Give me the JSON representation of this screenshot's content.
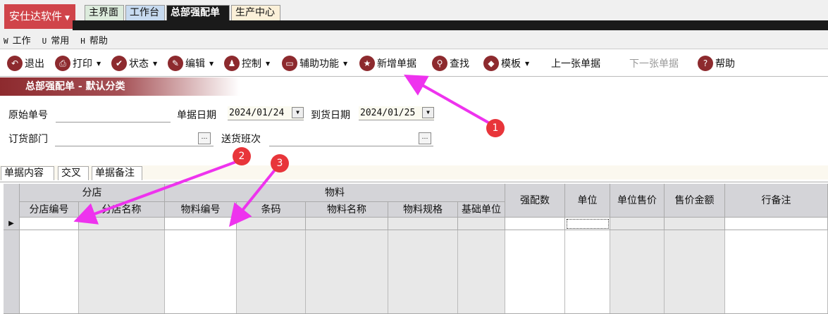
{
  "brand": {
    "label": "安仕达软件"
  },
  "window_tabs": [
    {
      "label": "主界面",
      "bg": "#dcebdc"
    },
    {
      "label": "工作台",
      "bg": "#c7daf0"
    },
    {
      "label": "总部强配单",
      "bg": "#1a1a1a",
      "active": true
    },
    {
      "label": "生产中心",
      "bg": "#fbf0d8"
    }
  ],
  "menu": [
    {
      "key": "W",
      "label": "工作"
    },
    {
      "key": "U",
      "label": "常用"
    },
    {
      "key": "H",
      "label": "帮助"
    }
  ],
  "toolbar": [
    {
      "label": "退出",
      "icon": "undo-icon",
      "glyph": "↶"
    },
    {
      "label": "打印",
      "icon": "printer-icon",
      "glyph": "⎙",
      "dropdown": true
    },
    {
      "label": "状态",
      "icon": "check-icon",
      "glyph": "✔",
      "dropdown": true
    },
    {
      "label": "编辑",
      "icon": "pencil-icon",
      "glyph": "✎",
      "dropdown": true
    },
    {
      "label": "控制",
      "icon": "user-icon",
      "glyph": "♟",
      "dropdown": true
    },
    {
      "label": "辅助功能",
      "icon": "folder-icon",
      "glyph": "▭",
      "dropdown": true
    },
    {
      "label": "新增单据",
      "icon": "star-icon",
      "glyph": "★"
    },
    {
      "label": "查找",
      "icon": "search-icon",
      "glyph": "⚲"
    },
    {
      "label": "模板",
      "icon": "eraser-icon",
      "glyph": "◆",
      "dropdown": true
    },
    {
      "label": "上一张单据"
    },
    {
      "label": "下一张单据",
      "disabled": true
    },
    {
      "label": "帮助",
      "icon": "help-icon",
      "glyph": "?"
    }
  ],
  "form_title": "总部强配单 - 默认分类",
  "form": {
    "orig_no_label": "原始单号",
    "orig_no_value": "",
    "doc_date_label": "单据日期",
    "doc_date_value": "2024/01/24",
    "arrive_date_label": "到货日期",
    "arrive_date_value": "2024/01/25",
    "dept_label": "订货部门",
    "dept_value": "",
    "shift_label": "送货班次",
    "shift_value": ""
  },
  "panel_tabs": [
    "单据内容",
    "交叉",
    "单据备注"
  ],
  "grid": {
    "groups": [
      {
        "label": "分店"
      },
      {
        "label": "物料"
      }
    ],
    "columns": [
      "分店编号",
      "分店名称",
      "物料编号",
      "条码",
      "物料名称",
      "物料规格",
      "基础单位",
      "强配数",
      "单位",
      "单位售价",
      "售价金额",
      "行备注"
    ],
    "rows": []
  },
  "annotations": [
    "1",
    "2",
    "3"
  ],
  "annotation_color": "#ee33ee"
}
